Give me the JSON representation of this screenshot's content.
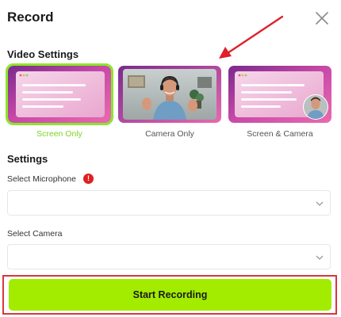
{
  "dialog": {
    "title": "Record",
    "close_icon": "close-icon"
  },
  "video_settings": {
    "heading": "Video Settings",
    "options": [
      {
        "label": "Screen Only",
        "selected": true
      },
      {
        "label": "Camera Only",
        "selected": false
      },
      {
        "label": "Screen & Camera",
        "selected": false
      }
    ]
  },
  "settings": {
    "heading": "Settings",
    "microphone": {
      "label": "Select Microphone",
      "value": "",
      "required_icon": "error-icon"
    },
    "camera": {
      "label": "Select Camera",
      "value": ""
    }
  },
  "actions": {
    "start_label": "Start Recording"
  },
  "colors": {
    "accent": "#a3ec00",
    "selected_outline": "#8ce62a",
    "selected_caption": "#7ed321",
    "error": "#e02020",
    "highlight_frame": "#d9363e",
    "annotation_arrow": "#e0202a"
  }
}
